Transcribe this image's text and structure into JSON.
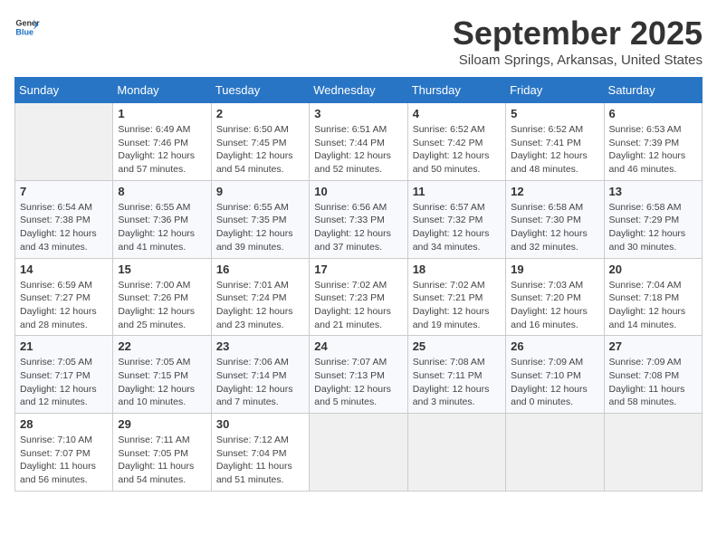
{
  "header": {
    "logo_line1": "General",
    "logo_line2": "Blue",
    "month": "September 2025",
    "location": "Siloam Springs, Arkansas, United States"
  },
  "columns": [
    "Sunday",
    "Monday",
    "Tuesday",
    "Wednesday",
    "Thursday",
    "Friday",
    "Saturday"
  ],
  "weeks": [
    [
      {
        "day": "",
        "info": ""
      },
      {
        "day": "1",
        "info": "Sunrise: 6:49 AM\nSunset: 7:46 PM\nDaylight: 12 hours\nand 57 minutes."
      },
      {
        "day": "2",
        "info": "Sunrise: 6:50 AM\nSunset: 7:45 PM\nDaylight: 12 hours\nand 54 minutes."
      },
      {
        "day": "3",
        "info": "Sunrise: 6:51 AM\nSunset: 7:44 PM\nDaylight: 12 hours\nand 52 minutes."
      },
      {
        "day": "4",
        "info": "Sunrise: 6:52 AM\nSunset: 7:42 PM\nDaylight: 12 hours\nand 50 minutes."
      },
      {
        "day": "5",
        "info": "Sunrise: 6:52 AM\nSunset: 7:41 PM\nDaylight: 12 hours\nand 48 minutes."
      },
      {
        "day": "6",
        "info": "Sunrise: 6:53 AM\nSunset: 7:39 PM\nDaylight: 12 hours\nand 46 minutes."
      }
    ],
    [
      {
        "day": "7",
        "info": "Sunrise: 6:54 AM\nSunset: 7:38 PM\nDaylight: 12 hours\nand 43 minutes."
      },
      {
        "day": "8",
        "info": "Sunrise: 6:55 AM\nSunset: 7:36 PM\nDaylight: 12 hours\nand 41 minutes."
      },
      {
        "day": "9",
        "info": "Sunrise: 6:55 AM\nSunset: 7:35 PM\nDaylight: 12 hours\nand 39 minutes."
      },
      {
        "day": "10",
        "info": "Sunrise: 6:56 AM\nSunset: 7:33 PM\nDaylight: 12 hours\nand 37 minutes."
      },
      {
        "day": "11",
        "info": "Sunrise: 6:57 AM\nSunset: 7:32 PM\nDaylight: 12 hours\nand 34 minutes."
      },
      {
        "day": "12",
        "info": "Sunrise: 6:58 AM\nSunset: 7:30 PM\nDaylight: 12 hours\nand 32 minutes."
      },
      {
        "day": "13",
        "info": "Sunrise: 6:58 AM\nSunset: 7:29 PM\nDaylight: 12 hours\nand 30 minutes."
      }
    ],
    [
      {
        "day": "14",
        "info": "Sunrise: 6:59 AM\nSunset: 7:27 PM\nDaylight: 12 hours\nand 28 minutes."
      },
      {
        "day": "15",
        "info": "Sunrise: 7:00 AM\nSunset: 7:26 PM\nDaylight: 12 hours\nand 25 minutes."
      },
      {
        "day": "16",
        "info": "Sunrise: 7:01 AM\nSunset: 7:24 PM\nDaylight: 12 hours\nand 23 minutes."
      },
      {
        "day": "17",
        "info": "Sunrise: 7:02 AM\nSunset: 7:23 PM\nDaylight: 12 hours\nand 21 minutes."
      },
      {
        "day": "18",
        "info": "Sunrise: 7:02 AM\nSunset: 7:21 PM\nDaylight: 12 hours\nand 19 minutes."
      },
      {
        "day": "19",
        "info": "Sunrise: 7:03 AM\nSunset: 7:20 PM\nDaylight: 12 hours\nand 16 minutes."
      },
      {
        "day": "20",
        "info": "Sunrise: 7:04 AM\nSunset: 7:18 PM\nDaylight: 12 hours\nand 14 minutes."
      }
    ],
    [
      {
        "day": "21",
        "info": "Sunrise: 7:05 AM\nSunset: 7:17 PM\nDaylight: 12 hours\nand 12 minutes."
      },
      {
        "day": "22",
        "info": "Sunrise: 7:05 AM\nSunset: 7:15 PM\nDaylight: 12 hours\nand 10 minutes."
      },
      {
        "day": "23",
        "info": "Sunrise: 7:06 AM\nSunset: 7:14 PM\nDaylight: 12 hours\nand 7 minutes."
      },
      {
        "day": "24",
        "info": "Sunrise: 7:07 AM\nSunset: 7:13 PM\nDaylight: 12 hours\nand 5 minutes."
      },
      {
        "day": "25",
        "info": "Sunrise: 7:08 AM\nSunset: 7:11 PM\nDaylight: 12 hours\nand 3 minutes."
      },
      {
        "day": "26",
        "info": "Sunrise: 7:09 AM\nSunset: 7:10 PM\nDaylight: 12 hours\nand 0 minutes."
      },
      {
        "day": "27",
        "info": "Sunrise: 7:09 AM\nSunset: 7:08 PM\nDaylight: 11 hours\nand 58 minutes."
      }
    ],
    [
      {
        "day": "28",
        "info": "Sunrise: 7:10 AM\nSunset: 7:07 PM\nDaylight: 11 hours\nand 56 minutes."
      },
      {
        "day": "29",
        "info": "Sunrise: 7:11 AM\nSunset: 7:05 PM\nDaylight: 11 hours\nand 54 minutes."
      },
      {
        "day": "30",
        "info": "Sunrise: 7:12 AM\nSunset: 7:04 PM\nDaylight: 11 hours\nand 51 minutes."
      },
      {
        "day": "",
        "info": ""
      },
      {
        "day": "",
        "info": ""
      },
      {
        "day": "",
        "info": ""
      },
      {
        "day": "",
        "info": ""
      }
    ]
  ]
}
